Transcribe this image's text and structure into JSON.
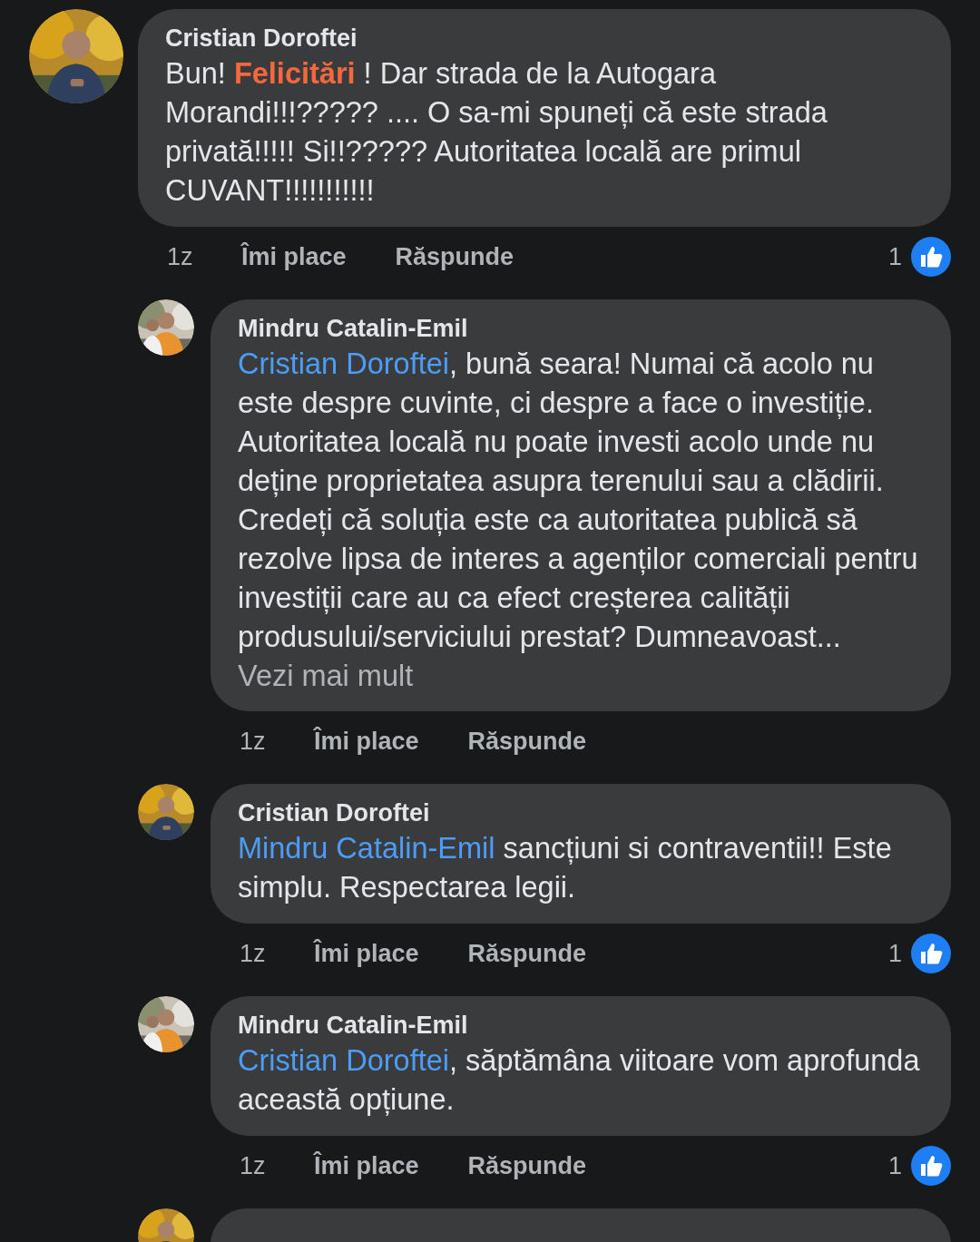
{
  "comments": [
    {
      "kind": "comment",
      "reply": false,
      "author": "Cristian Doroftei",
      "body": [
        {
          "kind": "plain",
          "text": "Bun! "
        },
        {
          "kind": "highlight",
          "text": "Felicitări"
        },
        {
          "kind": "plain",
          "text": " ! Dar strada de la Autogara Morandi!!!?????  .... O sa-mi spuneți  că este strada privată!!!!! Si!!????? Autoritatea locală are primul CUVANT!!!!!!!!!!!"
        }
      ],
      "time": "1z",
      "like": "Îmi place",
      "reply_label": "Răspunde",
      "reactions": "1"
    },
    {
      "kind": "comment",
      "reply": true,
      "author": "Mindru Catalin-Emil",
      "body": [
        {
          "kind": "mention",
          "text": "Cristian Doroftei"
        },
        {
          "kind": "plain",
          "text": ", bună seara! Numai că acolo nu este despre cuvinte, ci despre a face o investiție. Autoritatea locală nu poate investi acolo unde nu deține proprietatea asupra terenului sau a clădirii. Credeți că soluția este ca autoritatea publică să rezolve lipsa de interes a agenților comerciali pentru investiții care au ca efect creșterea calității produsului/serviciului prestat? Dumneavoast..."
        }
      ],
      "see_more": "Vezi mai mult",
      "time": "1z",
      "like": "Îmi place",
      "reply_label": "Răspunde"
    },
    {
      "kind": "comment",
      "reply": true,
      "author": "Cristian Doroftei",
      "body": [
        {
          "kind": "mention",
          "text": "Mindru Catalin-Emil"
        },
        {
          "kind": "plain",
          "text": " sancțiuni si contraventii!! Este simplu.  Respectarea legii."
        }
      ],
      "time": "1z",
      "like": "Îmi place",
      "reply_label": "Răspunde",
      "reactions": "1"
    },
    {
      "kind": "comment",
      "reply": true,
      "author": "Mindru Catalin-Emil",
      "body": [
        {
          "kind": "mention",
          "text": "Cristian Doroftei"
        },
        {
          "kind": "plain",
          "text": ", săptămâna viitoare vom aprofunda această opțiune."
        }
      ],
      "time": "1z",
      "like": "Îmi place",
      "reply_label": "Răspunde",
      "reactions": "1"
    },
    {
      "kind": "partial",
      "reply": true
    }
  ]
}
